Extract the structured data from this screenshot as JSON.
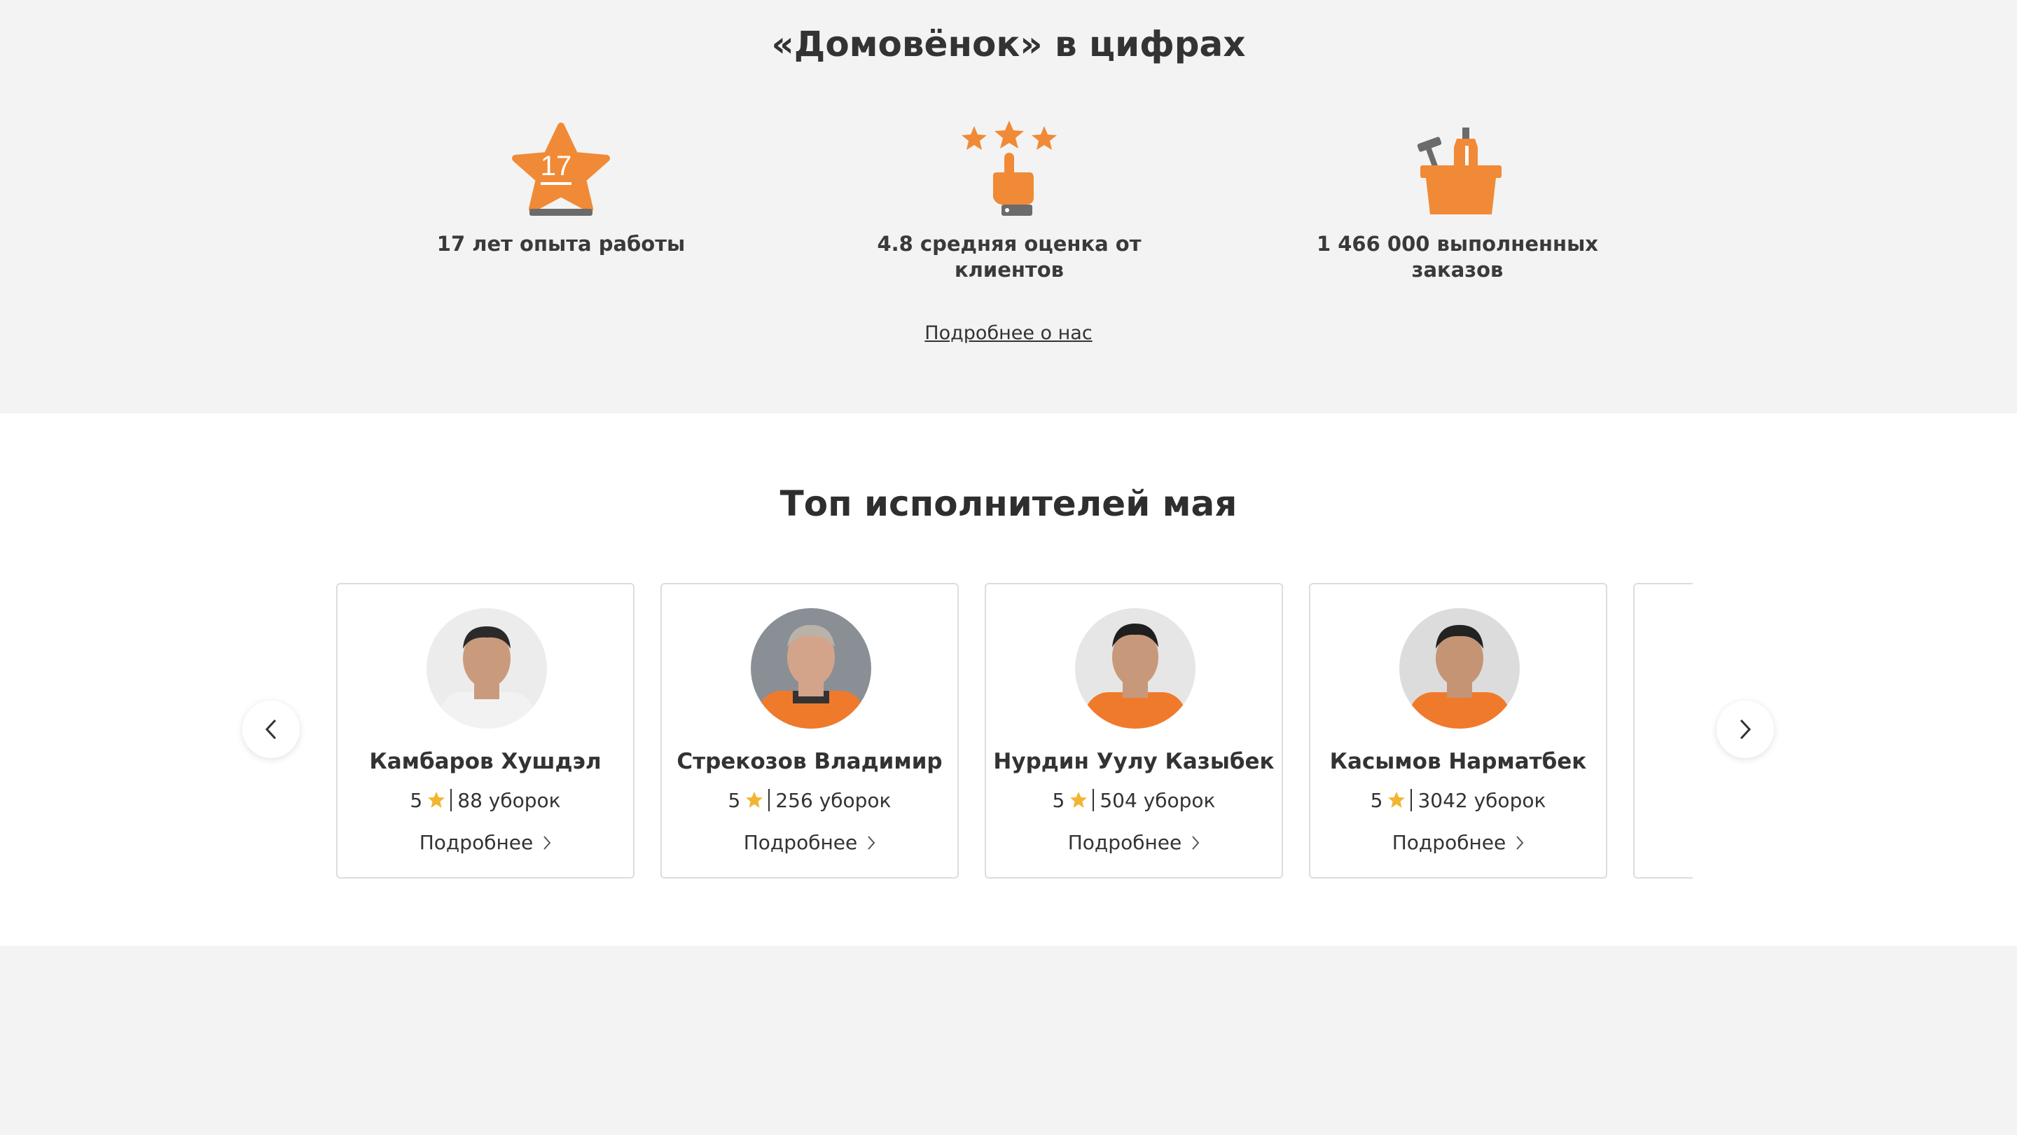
{
  "stats": {
    "title": "«Домовёнок» в цифрах",
    "items": [
      {
        "icon": "star-badge-icon",
        "badge_number": "17",
        "label": "17 лет опыта работы"
      },
      {
        "icon": "rating-stars-hand-icon",
        "label": "4.8 средняя оценка от клиентов"
      },
      {
        "icon": "cleaning-basket-icon",
        "label": "1 466 000 выполненных заказов"
      }
    ],
    "about_link": "Подробнее о нас"
  },
  "top": {
    "title": "Топ исполнителей мая",
    "cards": [
      {
        "name": "Камбаров Хушдэл",
        "rating": "5",
        "cleanings": "88 уборок",
        "more": "Подробнее",
        "shirt": "#f2f2f2"
      },
      {
        "name": "Стрекозов Владимир",
        "rating": "5",
        "cleanings": "256 уборок",
        "more": "Подробнее",
        "shirt": "#f07a2b"
      },
      {
        "name": "Нурдин Уулу Казыбек",
        "rating": "5",
        "cleanings": "504 уборок",
        "more": "Подробнее",
        "shirt": "#f07a2b"
      },
      {
        "name": "Касымов Нарматбек",
        "rating": "5",
        "cleanings": "3042 уборок",
        "more": "Подробнее",
        "shirt": "#f07a2b"
      }
    ],
    "prev_icon": "chevron-left-icon",
    "next_icon": "chevron-right-icon"
  },
  "colors": {
    "accent_orange": "#f08a36",
    "star_yellow": "#f2b532",
    "background_gray": "#f3f3f3"
  }
}
